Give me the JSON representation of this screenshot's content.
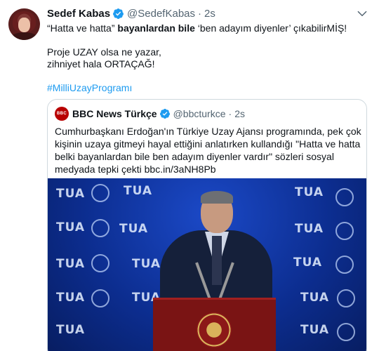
{
  "tweet": {
    "author_name": "Sedef Kabas",
    "author_handle": "@SedefKabas",
    "separator": "·",
    "time": "2s",
    "line1_prefix": "“Hatta ve hatta” ",
    "line1_bold": "bayanlardan bile",
    "line1_suffix": " ‘ben adayım diyenler’ çıkabilirMİŞ!",
    "line2": "Proje UZAY olsa ne yazar,",
    "line3": "zihniyet hala ORTAÇAĞ!",
    "hashtag": "#MilliUzayProgramı"
  },
  "quoted": {
    "avatar_text": "BBC",
    "author_name": "BBC News Türkçe",
    "author_handle": "@bbcturkce",
    "separator": "·",
    "time": "2s",
    "text": "Cumhurbaşkanı Erdoğan'ın Türkiye Uzay Ajansı programında, pek çok kişinin uzaya gitmeyi hayal ettiğini anlatırken kullandığı \"Hatta ve hatta belki bayanlardan bile ben adayım diyenler vardır\" sözleri sosyal medyada tepki çekti bbc.in/3aNH8Pb"
  },
  "media": {
    "logo_text": "TUA"
  },
  "colors": {
    "accent": "#1d9bf0",
    "secondary_text": "#536471",
    "bbc_red": "#b80000"
  },
  "icons": {
    "verified": "verified-badge-icon",
    "more": "chevron-down-icon"
  }
}
